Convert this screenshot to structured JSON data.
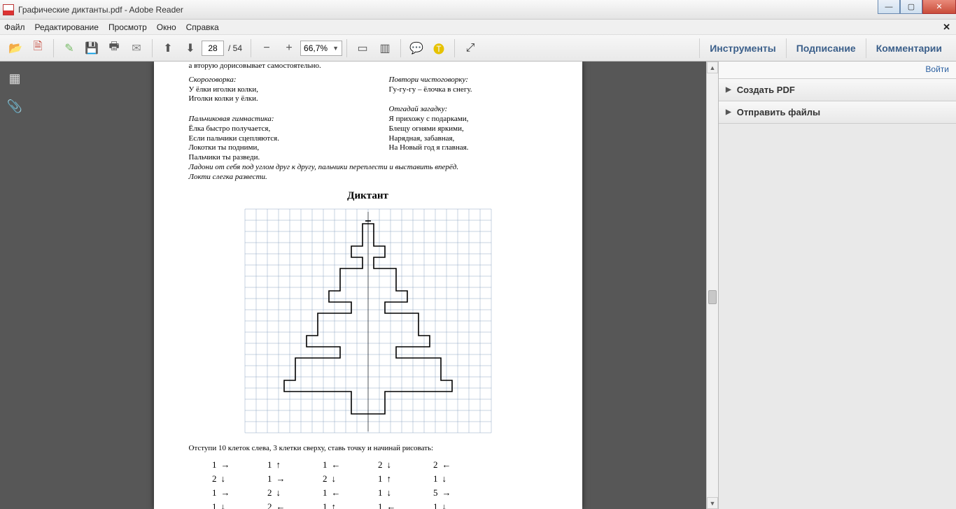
{
  "window": {
    "title": "Графические диктанты.pdf - Adobe Reader"
  },
  "menu": {
    "items": [
      "Файл",
      "Редактирование",
      "Просмотр",
      "Окно",
      "Справка"
    ]
  },
  "toolbar": {
    "page_current": "28",
    "page_total": "/ 54",
    "zoom": "66,7%"
  },
  "tool_tabs": {
    "tools": "Инструменты",
    "sign": "Подписание",
    "comments": "Комментарии"
  },
  "right_panel": {
    "login": "Войти",
    "create_pdf": "Создать PDF",
    "send_files": "Отправить файлы"
  },
  "doc": {
    "top_line": "а вторую дорисовывает самостоятельно.",
    "skorogovorka_h": "Скороговорка:",
    "skorogovorka_1": "У ёлки иголки колки,",
    "skorogovorka_2": "Иголки колки у ёлки.",
    "palchik_h": "Пальчиковая гимнастика:",
    "palchik_1": "Ёлка быстро получается,",
    "palchik_2": "Если пальчики сцепляются.",
    "palchik_3": "Локотки ты подними,",
    "palchik_4": "Пальчики ты разведи.",
    "palchik_note_1": "Ладони от себя под углом друг к другу, пальчики переплести и выставить вперёд.",
    "palchik_note_2": "Локти слегка развести.",
    "chisto_h": "Повтори чистоговорку:",
    "chisto_1": "Гу-гу-гу – ёлочка в снегу.",
    "zagadka_h": "Отгадай загадку:",
    "zagadka_1": "Я прихожу с подарками,",
    "zagadka_2": "Блещу огнями яркими,",
    "zagadka_3": "Нарядная, забавная,",
    "zagadka_4": "На Новый год я главная.",
    "diktant": "Диктант",
    "instructions": "Отступи 10 клеток слева, 3 клетки сверху, ставь точку и начинай рисовать:",
    "dir_cols": [
      [
        {
          "n": "1",
          "a": "→"
        },
        {
          "n": "2",
          "a": "↓"
        },
        {
          "n": "1",
          "a": "→"
        },
        {
          "n": "1",
          "a": "↓"
        }
      ],
      [
        {
          "n": "1",
          "a": "↑"
        },
        {
          "n": "1",
          "a": "→"
        },
        {
          "n": "2",
          "a": "↓"
        },
        {
          "n": "2",
          "a": "←"
        }
      ],
      [
        {
          "n": "1",
          "a": "←"
        },
        {
          "n": "2",
          "a": "↓"
        },
        {
          "n": "1",
          "a": "←"
        },
        {
          "n": "1",
          "a": "↑"
        }
      ],
      [
        {
          "n": "2",
          "a": "↓"
        },
        {
          "n": "1",
          "a": "↑"
        },
        {
          "n": "1",
          "a": "↓"
        },
        {
          "n": "1",
          "a": "←"
        }
      ],
      [
        {
          "n": "2",
          "a": "←"
        },
        {
          "n": "1",
          "a": "↓"
        },
        {
          "n": "5",
          "a": "→"
        },
        {
          "n": "1",
          "a": "↓"
        }
      ]
    ]
  }
}
